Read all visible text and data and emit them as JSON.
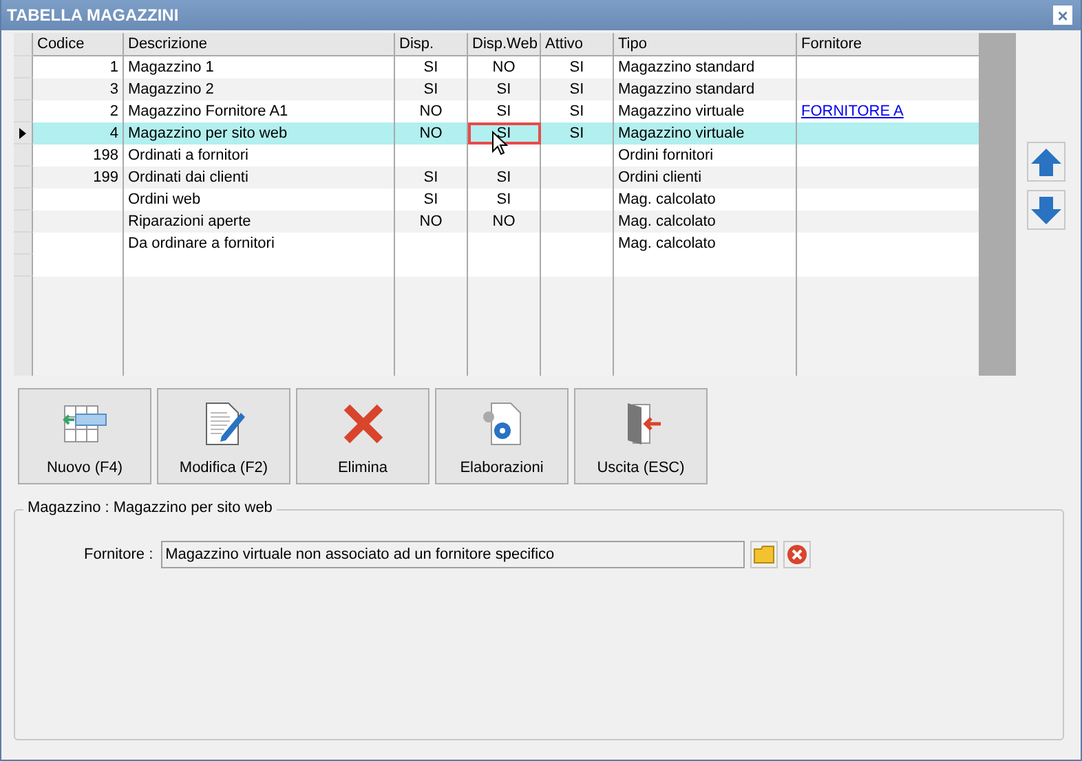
{
  "window": {
    "title": "TABELLA MAGAZZINI",
    "close": "×"
  },
  "table": {
    "columns": [
      "Codice",
      "Descrizione",
      "Disp.",
      "Disp.Web",
      "Attivo",
      "Tipo",
      "Fornitore"
    ],
    "rows": [
      {
        "codice": "1",
        "descrizione": "Magazzino 1",
        "disp": "SI",
        "disp_web": "NO",
        "attivo": "SI",
        "tipo": "Magazzino standard",
        "fornitore": "",
        "selected": false
      },
      {
        "codice": "3",
        "descrizione": "Magazzino 2",
        "disp": "SI",
        "disp_web": "SI",
        "attivo": "SI",
        "tipo": "Magazzino standard",
        "fornitore": "",
        "selected": false
      },
      {
        "codice": "2",
        "descrizione": "Magazzino Fornitore A1",
        "disp": "NO",
        "disp_web": "SI",
        "attivo": "SI",
        "tipo": "Magazzino virtuale",
        "fornitore": "FORNITORE A",
        "selected": false
      },
      {
        "codice": "4",
        "descrizione": "Magazzino per sito web",
        "disp": "NO",
        "disp_web": "SI",
        "attivo": "SI",
        "tipo": "Magazzino virtuale",
        "fornitore": "",
        "selected": true
      },
      {
        "codice": "198",
        "descrizione": "Ordinati a fornitori",
        "disp": "",
        "disp_web": "",
        "attivo": "",
        "tipo": "Ordini fornitori",
        "fornitore": "",
        "selected": false
      },
      {
        "codice": "199",
        "descrizione": "Ordinati dai clienti",
        "disp": "SI",
        "disp_web": "SI",
        "attivo": "",
        "tipo": "Ordini clienti",
        "fornitore": "",
        "selected": false
      },
      {
        "codice": "",
        "descrizione": "Ordini web",
        "disp": "SI",
        "disp_web": "SI",
        "attivo": "",
        "tipo": "Mag. calcolato",
        "fornitore": "",
        "selected": false
      },
      {
        "codice": "",
        "descrizione": "Riparazioni aperte",
        "disp": "NO",
        "disp_web": "NO",
        "attivo": "",
        "tipo": "Mag. calcolato",
        "fornitore": "",
        "selected": false
      },
      {
        "codice": "",
        "descrizione": "Da ordinare a fornitori",
        "disp": "",
        "disp_web": "",
        "attivo": "",
        "tipo": "Mag. calcolato",
        "fornitore": "",
        "selected": false
      }
    ]
  },
  "buttons": [
    {
      "kind": "new",
      "label": "Nuovo (F4)"
    },
    {
      "kind": "edit",
      "label": "Modifica (F2)"
    },
    {
      "kind": "delete",
      "label": "Elimina"
    },
    {
      "kind": "process",
      "label": "Elaborazioni"
    },
    {
      "kind": "exit",
      "label": "Uscita (ESC)"
    }
  ],
  "detail": {
    "legend": "Magazzino : Magazzino per sito web",
    "field_label": "Fornitore :",
    "field_value": "Magazzino virtuale non associato ad un fornitore specifico"
  }
}
